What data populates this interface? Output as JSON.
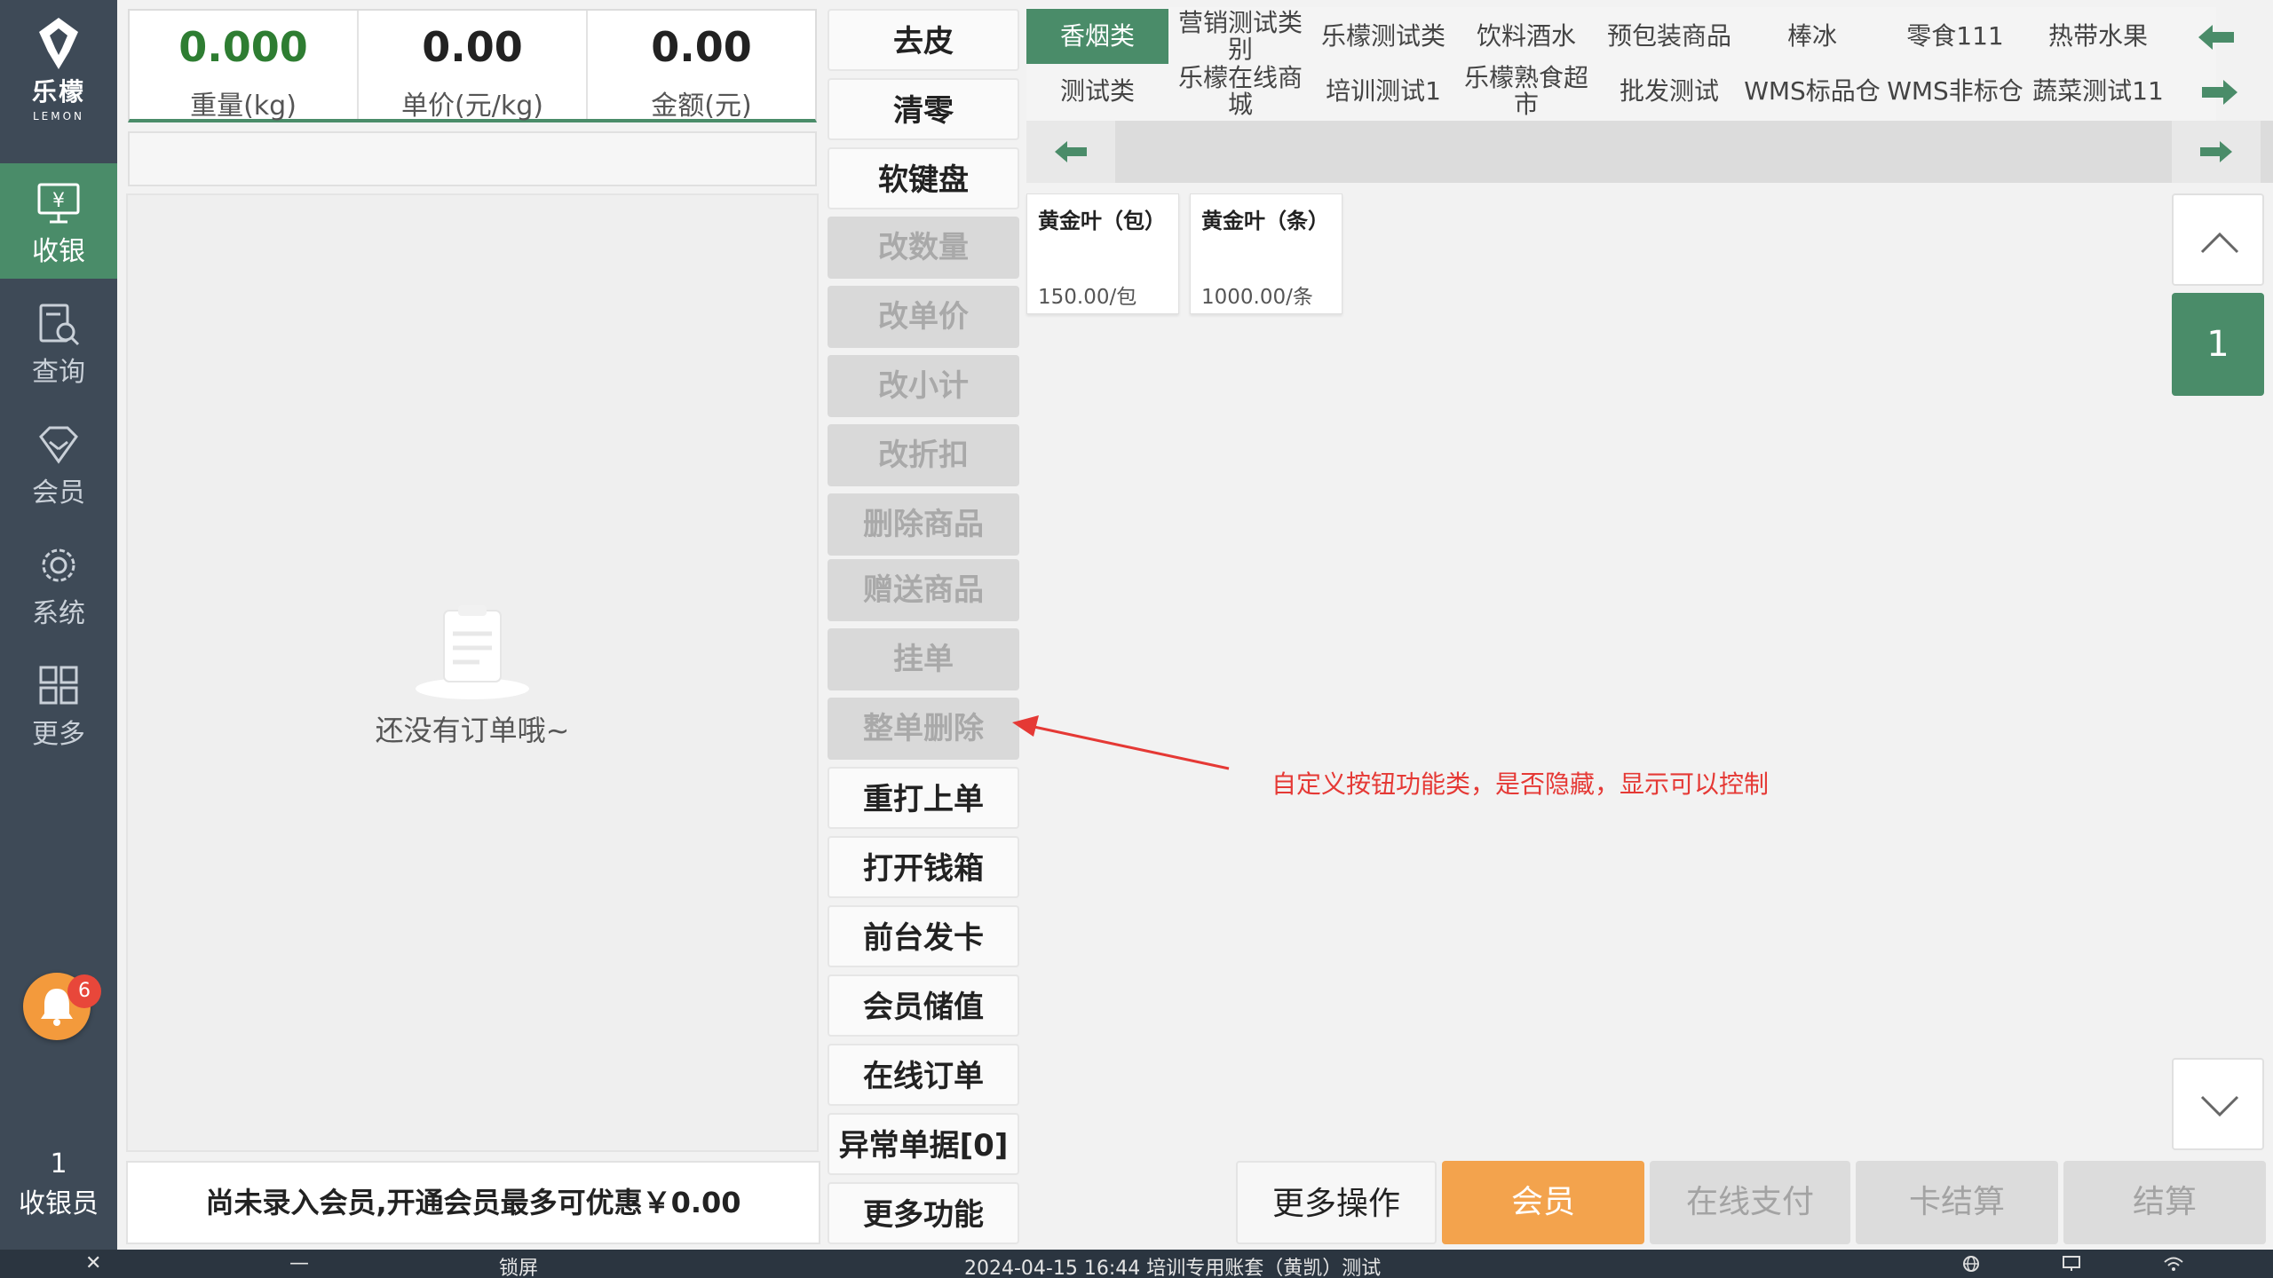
{
  "sidebar": {
    "logo_name": "乐檬",
    "logo_sub": "LEMON",
    "items": [
      {
        "label": "收银",
        "icon": "cashier-icon",
        "active": true
      },
      {
        "label": "查询",
        "icon": "query-icon",
        "active": false
      },
      {
        "label": "会员",
        "icon": "member-diamond-icon",
        "active": false
      },
      {
        "label": "系统",
        "icon": "gear-icon",
        "active": false
      },
      {
        "label": "更多",
        "icon": "grid-icon",
        "active": false
      }
    ],
    "notification_count": "6",
    "cashier_number": "1",
    "cashier_label": "收银员"
  },
  "scale": {
    "weight_value": "0.000",
    "weight_label": "重量(kg)",
    "unit_price_value": "0.00",
    "unit_price_label": "单价(元/kg)",
    "amount_value": "0.00",
    "amount_label": "金额(元)"
  },
  "order": {
    "empty_text": "还没有订单哦~",
    "member_tip": "尚未录入会员,开通会员最多可优惠￥0.00"
  },
  "functions": [
    {
      "label": "去皮",
      "enabled": true
    },
    {
      "label": "清零",
      "enabled": true
    },
    {
      "label": "软键盘",
      "enabled": true
    },
    {
      "label": "改数量",
      "enabled": false
    },
    {
      "label": "改单价",
      "enabled": false
    },
    {
      "label": "改小计",
      "enabled": false
    },
    {
      "label": "改折扣",
      "enabled": false
    },
    {
      "label": "删除商品",
      "enabled": false
    },
    {
      "label": "赠送商品",
      "enabled": false
    },
    {
      "label": "挂单",
      "enabled": false
    },
    {
      "label": "整单删除",
      "enabled": false
    },
    {
      "label": "重打上单",
      "enabled": true
    },
    {
      "label": "打开钱箱",
      "enabled": true
    },
    {
      "label": "前台发卡",
      "enabled": true
    },
    {
      "label": "会员储值",
      "enabled": true
    },
    {
      "label": "在线订单",
      "enabled": true
    },
    {
      "label": "异常单据[0]",
      "enabled": true
    },
    {
      "label": "更多功能",
      "enabled": true
    }
  ],
  "categories": {
    "row1": [
      "香烟类",
      "营销测试类别",
      "乐檬测试类",
      "饮料酒水",
      "预包装商品",
      "棒冰",
      "零食111",
      "热带水果"
    ],
    "row2": [
      "测试类",
      "乐檬在线商城",
      "培训测试1",
      "乐檬熟食超市",
      "批发测试",
      "WMS标品仓",
      "WMS非标仓",
      "蔬菜测试11"
    ],
    "selected": "香烟类"
  },
  "products": [
    {
      "name": "黄金叶（包）",
      "price": "150.00/包"
    },
    {
      "name": "黄金叶（条）",
      "price": "1000.00/条"
    }
  ],
  "pager": {
    "current_page": "1"
  },
  "annotation": "自定义按钮功能类，是否隐藏，显示可以控制",
  "actions": {
    "more": "更多操作",
    "member": "会员",
    "online_pay": "在线支付",
    "card_settle": "卡结算",
    "settle": "结算"
  },
  "statusbar": {
    "close": "✕",
    "minimize": "—",
    "lock": "锁屏",
    "info": "2024-04-15 16:44 培训专用账套（黄凯）测试"
  },
  "colors": {
    "primary_green": "#4a8c69",
    "sidebar_bg": "#3e4a57",
    "member_orange": "#f3a34d",
    "annotation_red": "#e53935"
  }
}
